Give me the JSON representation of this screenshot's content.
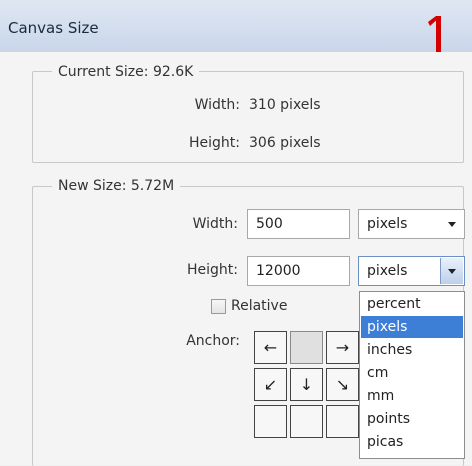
{
  "window": {
    "title": "Canvas Size"
  },
  "current_size": {
    "legend": "Current Size: 92.6K",
    "width_label": "Width:",
    "width_value": "310 pixels",
    "height_label": "Height:",
    "height_value": "306 pixels"
  },
  "new_size": {
    "legend": "New Size: 5.72M",
    "width_label": "Width:",
    "width_value": "500",
    "width_unit": "pixels",
    "height_label": "Height:",
    "height_value": "12000",
    "height_unit": "pixels",
    "relative_label": "Relative",
    "relative_checked": false,
    "anchor_label": "Anchor:"
  },
  "anchor": {
    "cells": [
      "←",
      "",
      "→",
      "↙",
      "↓",
      "↘",
      "",
      "",
      ""
    ]
  },
  "unit_dropdown": {
    "options": [
      "percent",
      "pixels",
      "inches",
      "cm",
      "mm",
      "points",
      "picas"
    ],
    "selected": "pixels"
  },
  "colors": {
    "selection": "#3d7fd7",
    "annotation": "#d40000"
  },
  "annotation": {
    "label": "1"
  }
}
